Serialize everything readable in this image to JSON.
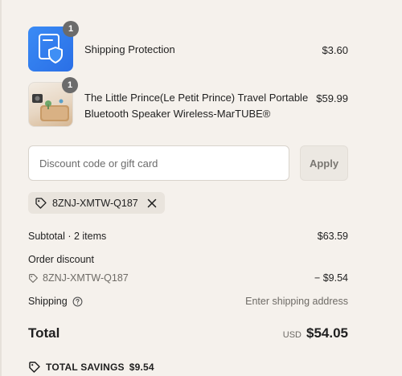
{
  "items": [
    {
      "name": "Shipping Protection",
      "price": "$3.60",
      "quantity": "1",
      "icon": "shield-document-icon"
    },
    {
      "name_line1": "The Little Prince(Le Petit Prince) Travel Portable",
      "name_line2": "Bluetooth Speaker Wireless-MarTUBE®",
      "price": "$59.99",
      "quantity": "1",
      "icon": "product-photo"
    }
  ],
  "discount": {
    "placeholder": "Discount code or gift card",
    "apply_label": "Apply",
    "applied_code": "8ZNJ-XMTW-Q187"
  },
  "summary": {
    "subtotal_label": "Subtotal · 2 items",
    "subtotal_value": "$63.59",
    "order_discount_label": "Order discount",
    "discount_code": "8ZNJ-XMTW-Q187",
    "discount_value": "− $9.54",
    "shipping_label": "Shipping",
    "shipping_value": "Enter shipping address",
    "total_label": "Total",
    "total_currency": "USD",
    "total_value": "$54.05",
    "savings_label": "TOTAL SAVINGS",
    "savings_value": "$9.54"
  },
  "colors": {
    "background": "#f5f1ec",
    "protection_blue": "#2f7cf0",
    "chip_bg": "#e9e4dd"
  }
}
